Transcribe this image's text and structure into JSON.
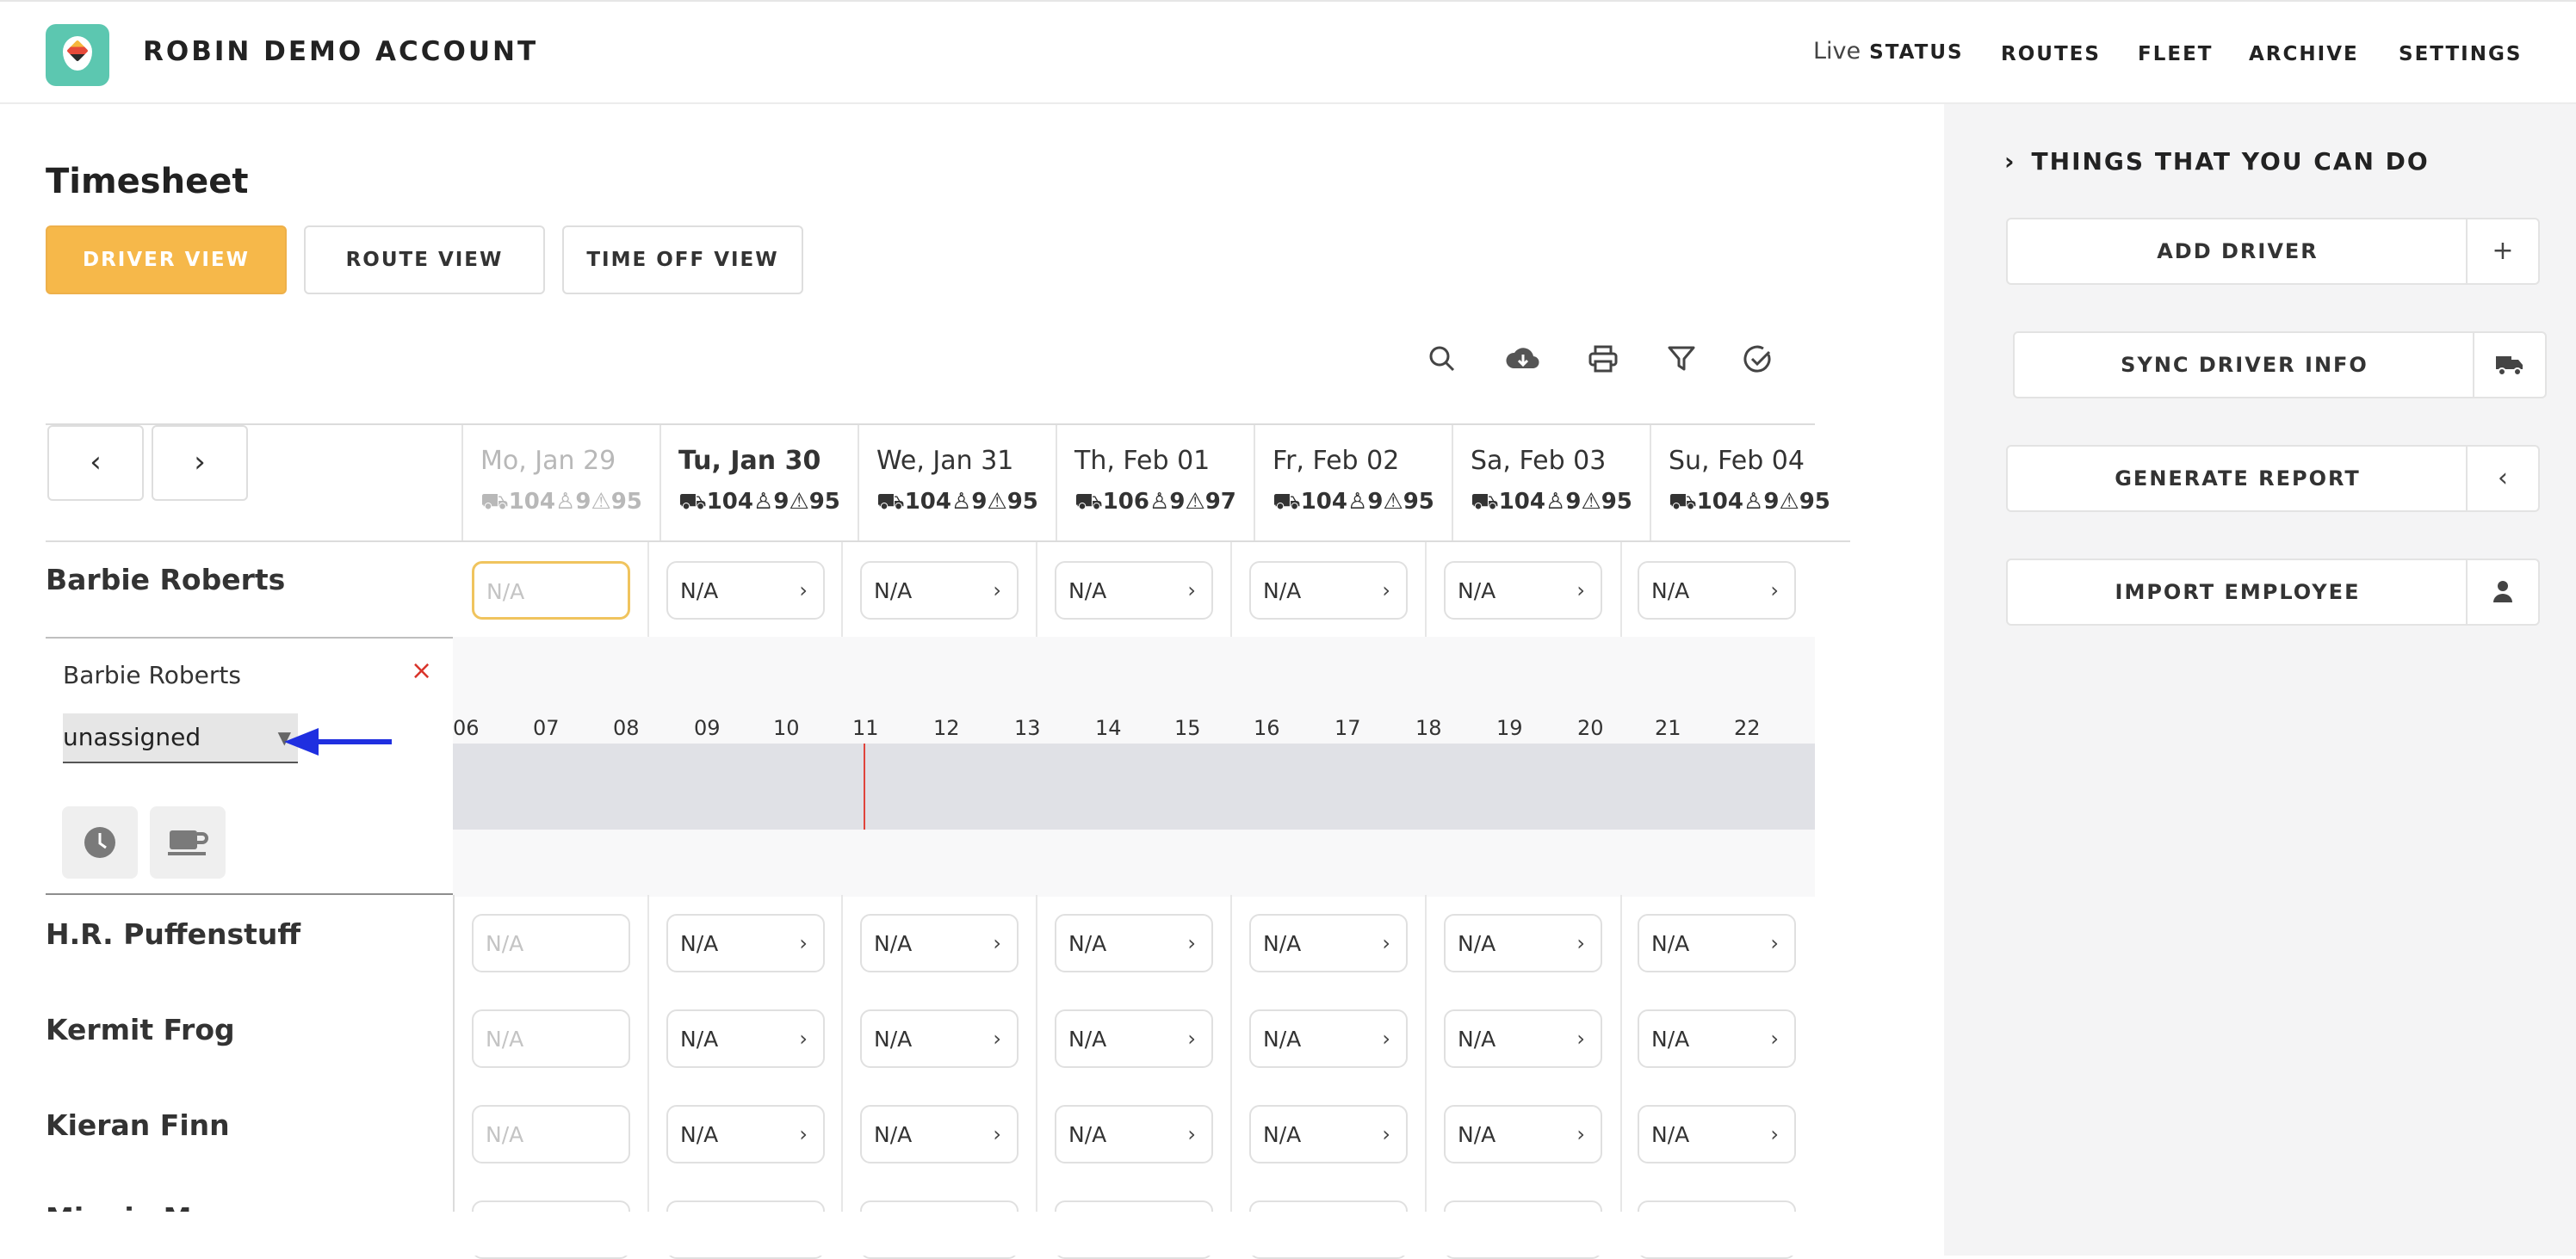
{
  "header": {
    "app_title": "ROBIN DEMO ACCOUNT",
    "nav": {
      "live_prefix": "Live",
      "status": "STATUS",
      "routes": "ROUTES",
      "fleet": "FLEET",
      "archive": "ARCHIVE",
      "settings": "SETTINGS"
    }
  },
  "page": {
    "title": "Timesheet",
    "views": {
      "driver": "DRIVER VIEW",
      "route": "ROUTE VIEW",
      "time_off": "TIME OFF VIEW"
    }
  },
  "toolbar": {
    "prev": "‹",
    "next": "›"
  },
  "days": [
    {
      "date": "Mo, Jan 29",
      "trucks": "104",
      "drivers": "9",
      "alerts": "95"
    },
    {
      "date": "Tu, Jan 30",
      "trucks": "104",
      "drivers": "9",
      "alerts": "95"
    },
    {
      "date": "We, Jan 31",
      "trucks": "104",
      "drivers": "9",
      "alerts": "95"
    },
    {
      "date": "Th, Feb 01",
      "trucks": "106",
      "drivers": "9",
      "alerts": "97"
    },
    {
      "date": "Fr, Feb 02",
      "trucks": "104",
      "drivers": "9",
      "alerts": "95"
    },
    {
      "date": "Sa, Feb 03",
      "trucks": "104",
      "drivers": "9",
      "alerts": "95"
    },
    {
      "date": "Su, Feb 04",
      "trucks": "104",
      "drivers": "9",
      "alerts": "95"
    }
  ],
  "cell_value": "N/A",
  "drivers": [
    "Barbie Roberts",
    "H.R. Puffenstuff",
    "Kermit Frog",
    "Kieran Finn",
    "Miggie M"
  ],
  "expanded": {
    "name": "Barbie Roberts",
    "close": "×",
    "select_value": "unassigned",
    "hours": [
      "06",
      "07",
      "08",
      "09",
      "10",
      "11",
      "12",
      "13",
      "14",
      "15",
      "16",
      "17",
      "18",
      "19",
      "20",
      "21",
      "22"
    ]
  },
  "side": {
    "heading": "THINGS THAT YOU CAN DO",
    "actions": [
      "ADD DRIVER",
      "SYNC DRIVER INFO",
      "GENERATE REPORT",
      "IMPORT EMPLOYEE"
    ]
  },
  "colors": {
    "accent": "#f6b84a",
    "brand": "#5cc7b0",
    "now_line": "#e0443c",
    "arrow": "#1f2fe0"
  }
}
